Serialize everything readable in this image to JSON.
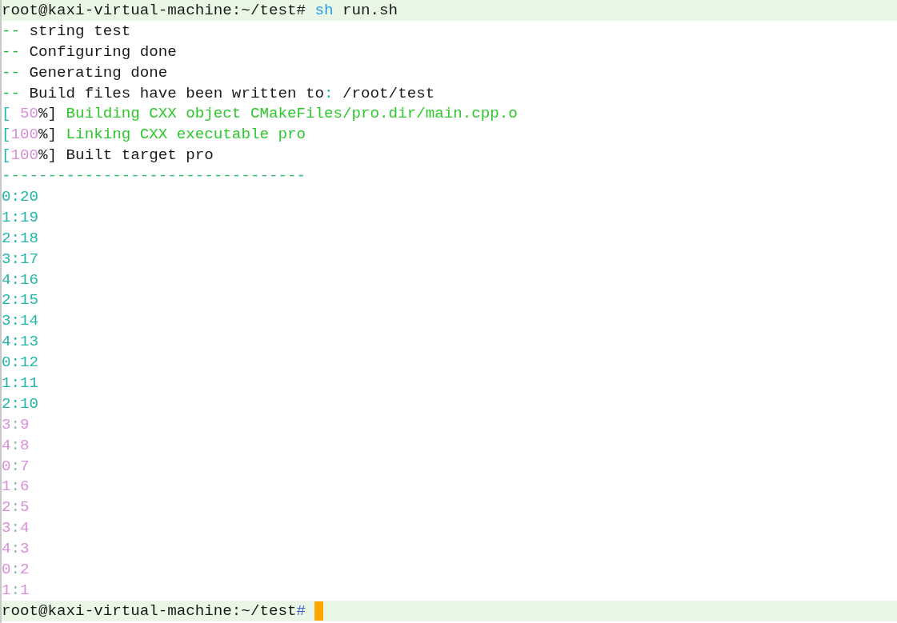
{
  "terminal": {
    "lines": [
      {
        "kind": "prompt",
        "cursor": false,
        "segments": [
          {
            "text": "root@kaxi-virtual-machine:~/test# ",
            "color": "#1a1a1a"
          },
          {
            "text": "sh",
            "color": "#2b9cf0"
          },
          {
            "text": " run.sh",
            "color": "#1a1a1a"
          }
        ]
      },
      {
        "kind": "output",
        "segments": [
          {
            "text": "--",
            "color": "#22b14c"
          },
          {
            "text": " string test",
            "color": "#1a1a1a"
          }
        ]
      },
      {
        "kind": "output",
        "segments": [
          {
            "text": "--",
            "color": "#22b14c"
          },
          {
            "text": " Configuring done",
            "color": "#1a1a1a"
          }
        ]
      },
      {
        "kind": "output",
        "segments": [
          {
            "text": "--",
            "color": "#22b14c"
          },
          {
            "text": " Generating done",
            "color": "#1a1a1a"
          }
        ]
      },
      {
        "kind": "output",
        "segments": [
          {
            "text": "--",
            "color": "#22b14c"
          },
          {
            "text": " Build files have been written to",
            "color": "#1a1a1a"
          },
          {
            "text": ":",
            "color": "#22b5a8"
          },
          {
            "text": " /root/test",
            "color": "#1a1a1a"
          }
        ]
      },
      {
        "kind": "output",
        "segments": [
          {
            "text": "[",
            "color": "#22b5a8"
          },
          {
            "text": " 50",
            "color": "#d98fd9"
          },
          {
            "text": "%]",
            "color": "#1a1a1a"
          },
          {
            "text": " Building CXX object CMakeFiles/pro.dir/main.cpp.o",
            "color": "#2ec82e"
          }
        ]
      },
      {
        "kind": "output",
        "segments": [
          {
            "text": "[",
            "color": "#22b5a8"
          },
          {
            "text": "100",
            "color": "#d98fd9"
          },
          {
            "text": "%]",
            "color": "#1a1a1a"
          },
          {
            "text": " Linking CXX executable pro",
            "color": "#2ec82e"
          }
        ]
      },
      {
        "kind": "output",
        "segments": [
          {
            "text": "[",
            "color": "#22b5a8"
          },
          {
            "text": "100",
            "color": "#d98fd9"
          },
          {
            "text": "%] Built target pro",
            "color": "#1a1a1a"
          }
        ]
      },
      {
        "kind": "output",
        "segments": [
          {
            "text": "---------------------------------",
            "color": "#2fb872"
          }
        ]
      },
      {
        "kind": "output",
        "segments": [
          {
            "text": "0:20",
            "color": "#22b5a8"
          }
        ]
      },
      {
        "kind": "output",
        "segments": [
          {
            "text": "1:19",
            "color": "#22b5a8"
          }
        ]
      },
      {
        "kind": "output",
        "segments": [
          {
            "text": "2:18",
            "color": "#22b5a8"
          }
        ]
      },
      {
        "kind": "output",
        "segments": [
          {
            "text": "3:17",
            "color": "#22b5a8"
          }
        ]
      },
      {
        "kind": "output",
        "segments": [
          {
            "text": "4:16",
            "color": "#22b5a8"
          }
        ]
      },
      {
        "kind": "output",
        "segments": [
          {
            "text": "2:15",
            "color": "#22b5a8"
          }
        ]
      },
      {
        "kind": "output",
        "segments": [
          {
            "text": "3:14",
            "color": "#22b5a8"
          }
        ]
      },
      {
        "kind": "output",
        "segments": [
          {
            "text": "4:13",
            "color": "#22b5a8"
          }
        ]
      },
      {
        "kind": "output",
        "segments": [
          {
            "text": "0:12",
            "color": "#22b5a8"
          }
        ]
      },
      {
        "kind": "output",
        "segments": [
          {
            "text": "1:11",
            "color": "#22b5a8"
          }
        ]
      },
      {
        "kind": "output",
        "segments": [
          {
            "text": "2:10",
            "color": "#22b5a8"
          }
        ]
      },
      {
        "kind": "output",
        "segments": [
          {
            "text": "3",
            "color": "#d98fd9"
          },
          {
            "text": ":",
            "color": "#8fb8b0"
          },
          {
            "text": "9",
            "color": "#d98fd9"
          }
        ]
      },
      {
        "kind": "output",
        "segments": [
          {
            "text": "4",
            "color": "#d98fd9"
          },
          {
            "text": ":",
            "color": "#8fb8b0"
          },
          {
            "text": "8",
            "color": "#d98fd9"
          }
        ]
      },
      {
        "kind": "output",
        "segments": [
          {
            "text": "0",
            "color": "#d98fd9"
          },
          {
            "text": ":",
            "color": "#8fb8b0"
          },
          {
            "text": "7",
            "color": "#d98fd9"
          }
        ]
      },
      {
        "kind": "output",
        "segments": [
          {
            "text": "1",
            "color": "#d98fd9"
          },
          {
            "text": ":",
            "color": "#8fb8b0"
          },
          {
            "text": "6",
            "color": "#d98fd9"
          }
        ]
      },
      {
        "kind": "output",
        "segments": [
          {
            "text": "2",
            "color": "#d98fd9"
          },
          {
            "text": ":",
            "color": "#8fb8b0"
          },
          {
            "text": "5",
            "color": "#d98fd9"
          }
        ]
      },
      {
        "kind": "output",
        "segments": [
          {
            "text": "3",
            "color": "#d98fd9"
          },
          {
            "text": ":",
            "color": "#8fb8b0"
          },
          {
            "text": "4",
            "color": "#d98fd9"
          }
        ]
      },
      {
        "kind": "output",
        "segments": [
          {
            "text": "4",
            "color": "#d98fd9"
          },
          {
            "text": ":",
            "color": "#8fb8b0"
          },
          {
            "text": "3",
            "color": "#d98fd9"
          }
        ]
      },
      {
        "kind": "output",
        "segments": [
          {
            "text": "0",
            "color": "#d98fd9"
          },
          {
            "text": ":",
            "color": "#8fb8b0"
          },
          {
            "text": "2",
            "color": "#d98fd9"
          }
        ]
      },
      {
        "kind": "output",
        "segments": [
          {
            "text": "1",
            "color": "#d98fd9"
          },
          {
            "text": ":",
            "color": "#8fb8b0"
          },
          {
            "text": "1",
            "color": "#d98fd9"
          }
        ]
      },
      {
        "kind": "prompt",
        "cursor": true,
        "segments": [
          {
            "text": "root@kaxi-virtual-machine:~/test",
            "color": "#1a1a1a"
          },
          {
            "text": "#",
            "color": "#3a5fc8"
          }
        ]
      }
    ]
  }
}
